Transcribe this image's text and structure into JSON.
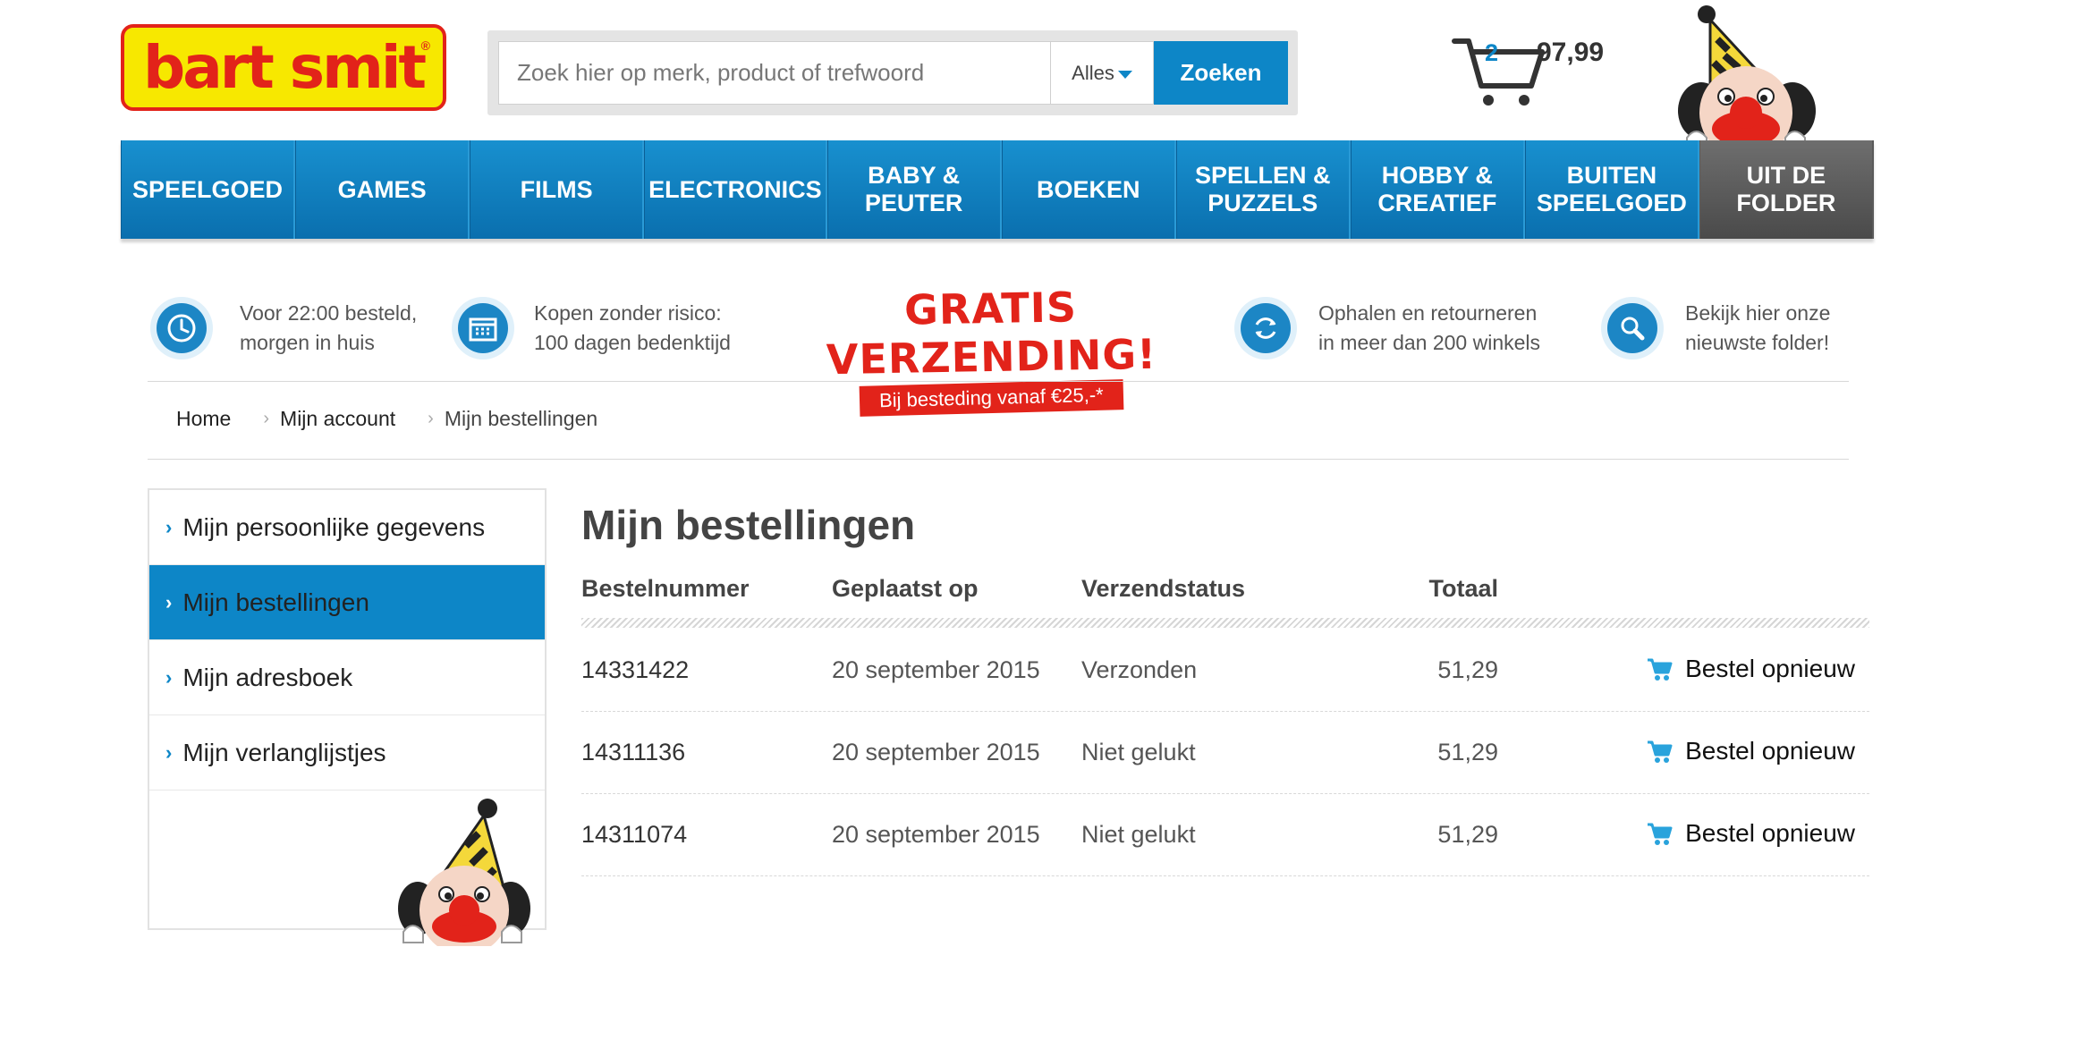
{
  "header": {
    "logo_text": "bart smit",
    "search_placeholder": "Zoek hier op merk, product of trefwoord",
    "search_scope": "Alles",
    "search_button": "Zoeken",
    "cart_count": "2",
    "cart_total": "97,99"
  },
  "nav": [
    {
      "label": "SPEELGOED"
    },
    {
      "label": "GAMES"
    },
    {
      "label": "FILMS"
    },
    {
      "label": "ELECTRONICS"
    },
    {
      "label": "BABY &\nPEUTER"
    },
    {
      "label": "BOEKEN"
    },
    {
      "label": "SPELLEN &\nPUZZELS"
    },
    {
      "label": "HOBBY &\nCREATIEF"
    },
    {
      "label": "BUITEN\nSPEELGOED"
    },
    {
      "label": "UIT DE\nFOLDER"
    }
  ],
  "usps": [
    {
      "icon": "clock-icon",
      "line1": "Voor 22:00 besteld,",
      "line2": "morgen in huis"
    },
    {
      "icon": "calendar-icon",
      "line1": "Kopen zonder risico:",
      "line2": "100 dagen bedenktijd"
    },
    {
      "icon": "refresh-icon",
      "line1": "Ophalen en retourneren",
      "line2": "in meer dan 200 winkels"
    },
    {
      "icon": "magnifier-icon",
      "line1": "Bekijk hier onze",
      "line2": "nieuwste folder!"
    }
  ],
  "promo": {
    "title": "GRATIS VERZENDING!",
    "subtitle": "Bij besteding vanaf €25,-*"
  },
  "breadcrumb": [
    "Home",
    "Mijn account",
    "Mijn bestellingen"
  ],
  "sidebar": [
    {
      "label": "Mijn persoonlijke gegevens"
    },
    {
      "label": "Mijn bestellingen",
      "active": true
    },
    {
      "label": "Mijn adresboek"
    },
    {
      "label": "Mijn verlanglijstjes"
    }
  ],
  "orders": {
    "title": "Mijn bestellingen",
    "columns": [
      "Bestelnummer",
      "Geplaatst op",
      "Verzendstatus",
      "Totaal"
    ],
    "reorder_label": "Bestel opnieuw",
    "rows": [
      {
        "number": "14331422",
        "date": "20 september 2015",
        "status": "Verzonden",
        "total": "51,29"
      },
      {
        "number": "14311136",
        "date": "20 september 2015",
        "status": "Niet gelukt",
        "total": "51,29"
      },
      {
        "number": "14311074",
        "date": "20 september 2015",
        "status": "Niet gelukt",
        "total": "51,29"
      }
    ]
  },
  "colors": {
    "brand_blue": "#0d86c7",
    "brand_red": "#e2231a",
    "brand_yellow": "#f7e800",
    "folder_gray": "#555555"
  }
}
